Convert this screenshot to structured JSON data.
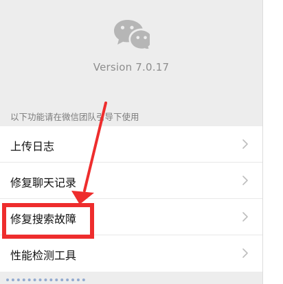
{
  "app": {
    "logo_icon": "wechat-logo-icon",
    "version": "Version 7.0.17"
  },
  "section": {
    "title": "以下功能请在微信团队引导下使用"
  },
  "menu": {
    "items": [
      {
        "label": "上传日志",
        "icon": "chevron-right-icon"
      },
      {
        "label": "修复聊天记录",
        "icon": "chevron-right-icon"
      },
      {
        "label": "修复搜索故障",
        "icon": "chevron-right-icon"
      },
      {
        "label": "性能检测工具",
        "icon": "chevron-right-icon"
      }
    ]
  },
  "annotation": {
    "arrow_color": "#ee2d2d",
    "highlight_color": "#ee2d2d"
  },
  "colors": {
    "background": "#ededed",
    "menu_background": "#ffffff",
    "text": "#111111",
    "secondary_text": "#8d8d8d",
    "chevron": "#bdbdbd"
  }
}
